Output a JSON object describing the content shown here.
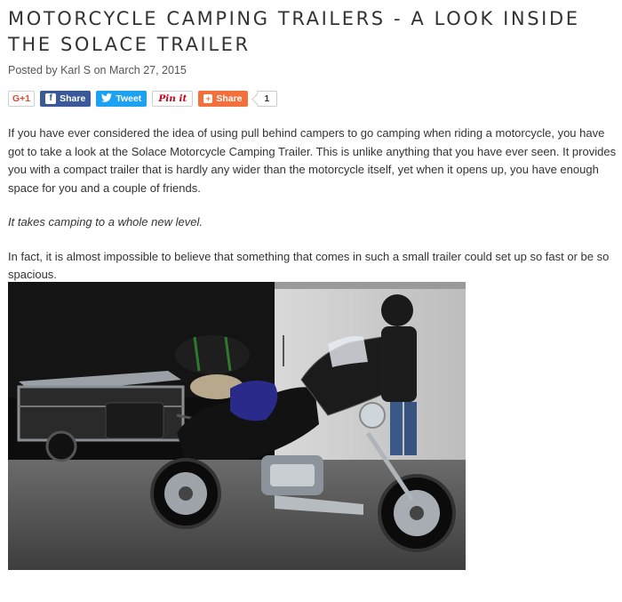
{
  "article": {
    "title": "MOTORCYCLE CAMPING TRAILERS - A LOOK INSIDE THE SOLACE TRAILER",
    "meta": {
      "prefix": "Posted by",
      "author": "Karl S",
      "on": "on",
      "date": "March 27, 2015"
    },
    "share": {
      "gplus": "G+1",
      "facebook": "Share",
      "facebook_icon": "f",
      "twitter": "Tweet",
      "pinterest": "Pin it",
      "share": "Share",
      "share_icon": "+",
      "count": "1"
    },
    "paragraphs": {
      "p1": "If you have ever considered the idea of using pull behind campers to go camping when riding a motorcycle, you have got to take a look at the Solace Motorcycle Camping Trailer. This is unlike anything that you have ever seen. It provides you with a compact trailer that is hardly any wider than the motorcycle itself, yet when it opens up, you have enough space for you and a couple of friends.",
      "p2": "It takes camping to a whole new level.",
      "p3": "In fact, it is almost impossible to believe that something that comes in such a small trailer could set up so fast or be so spacious."
    },
    "photo_icon": "motorcycle-with-trailer-photo"
  },
  "colors": {
    "facebook": "#3b5998",
    "twitter": "#1da1f2",
    "pinterest": "#bd081c",
    "share": "#f36f3b",
    "gplus": "#dd4b39"
  }
}
